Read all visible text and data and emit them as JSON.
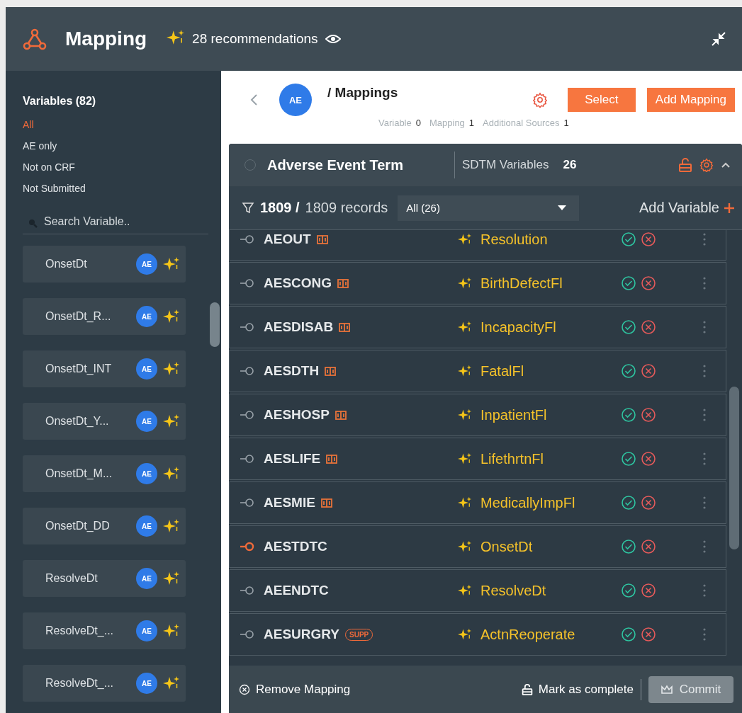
{
  "header": {
    "title": "Mapping",
    "recommendations": "28 recommendations"
  },
  "sidebar": {
    "title": "Variables (82)",
    "filters": [
      {
        "label": "All",
        "selected": true
      },
      {
        "label": "AE only",
        "selected": false
      },
      {
        "label": "Not on CRF",
        "selected": false
      },
      {
        "label": "Not Submitted",
        "selected": false
      }
    ],
    "search": {
      "placeholder": "Search Variable.."
    },
    "items": [
      {
        "label": "OnsetDt",
        "badge": "AE"
      },
      {
        "label": "OnsetDt_R...",
        "badge": "AE"
      },
      {
        "label": "OnsetDt_INT",
        "badge": "AE"
      },
      {
        "label": "OnsetDt_Y...",
        "badge": "AE"
      },
      {
        "label": "OnsetDt_M...",
        "badge": "AE"
      },
      {
        "label": "OnsetDt_DD",
        "badge": "AE"
      },
      {
        "label": "ResolveDt",
        "badge": "AE"
      },
      {
        "label": "ResolveDt_...",
        "badge": "AE"
      },
      {
        "label": "ResolveDt_...",
        "badge": "AE"
      }
    ]
  },
  "topbar": {
    "avatar": "AE",
    "breadcrumb": "/ Mappings",
    "buttons": [
      "Select",
      "Add Mapping"
    ],
    "stats": [
      {
        "label": "Variable",
        "value": "0"
      },
      {
        "label": "Mapping",
        "value": "1"
      },
      {
        "label": "Additional Sources",
        "value": "1"
      }
    ]
  },
  "card": {
    "title": "Adverse Event Term",
    "sdtm_label": "SDTM Variables",
    "sdtm_count": "26",
    "count": "1809 /",
    "records": "1809 records",
    "dropdown": "All (26)",
    "add_variable": "Add Variable",
    "rows": [
      {
        "source": "AEOUT",
        "tag": {
          "kind": "book"
        },
        "target": "Resolution",
        "linked": false
      },
      {
        "source": "AESCONG",
        "tag": {
          "kind": "book"
        },
        "target": "BirthDefectFl",
        "linked": false
      },
      {
        "source": "AESDISAB",
        "tag": {
          "kind": "book"
        },
        "target": "IncapacityFl",
        "linked": false
      },
      {
        "source": "AESDTH",
        "tag": {
          "kind": "book"
        },
        "target": "FatalFl",
        "linked": false
      },
      {
        "source": "AESHOSP",
        "tag": {
          "kind": "book"
        },
        "target": "InpatientFl",
        "linked": false
      },
      {
        "source": "AESLIFE",
        "tag": {
          "kind": "book"
        },
        "target": "LifethrtnFl",
        "linked": false
      },
      {
        "source": "AESMIE",
        "tag": {
          "kind": "book"
        },
        "target": "MedicallyImpFl",
        "linked": false
      },
      {
        "source": "AESTDTC",
        "target": "OnsetDt",
        "linked": true
      },
      {
        "source": "AEENDTC",
        "target": "ResolveDt",
        "linked": false
      },
      {
        "source": "AESURGRY",
        "tag": {
          "kind": "supp",
          "label": "SUPP"
        },
        "target": "ActnReoperate",
        "linked": false
      }
    ],
    "footer": {
      "remove": "Remove Mapping",
      "complete": "Mark as complete",
      "commit": "Commit",
      "commit_disabled": true
    }
  }
}
